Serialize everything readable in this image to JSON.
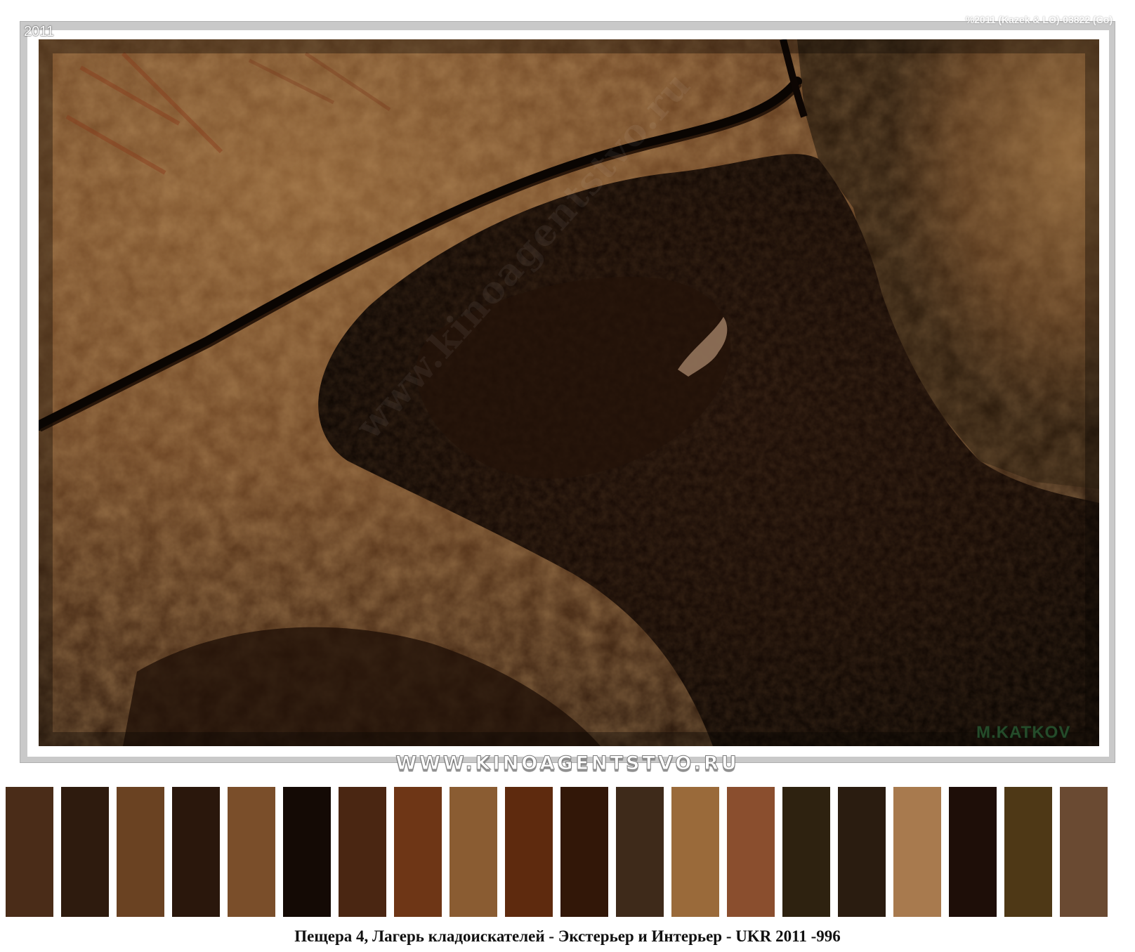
{
  "photo": {
    "year": "2011",
    "copyright": "%2011 (Kazek & LO)-03822 (Co)",
    "photographer": "M.KATKOV",
    "watermark": "www.kinoagentstvo.ru"
  },
  "website": "WWW.KINOAGENTSTVO.RU",
  "caption": "Пещера 4, Лагерь кладоискателей - Экстерьер и Интерьер - UKR 2011 -996",
  "palette": [
    "#4a2c18",
    "#2e1b0e",
    "#6a4222",
    "#2a170c",
    "#7a4e2a",
    "#140a05",
    "#4a2612",
    "#6e3616",
    "#8a5c32",
    "#5e2a0e",
    "#321708",
    "#3e2a1a",
    "#9a6a3a",
    "#8a4e2e",
    "#2e2210",
    "#2a1c10",
    "#a87a4e",
    "#1e0e08",
    "#4e3816",
    "#6a4a32"
  ]
}
